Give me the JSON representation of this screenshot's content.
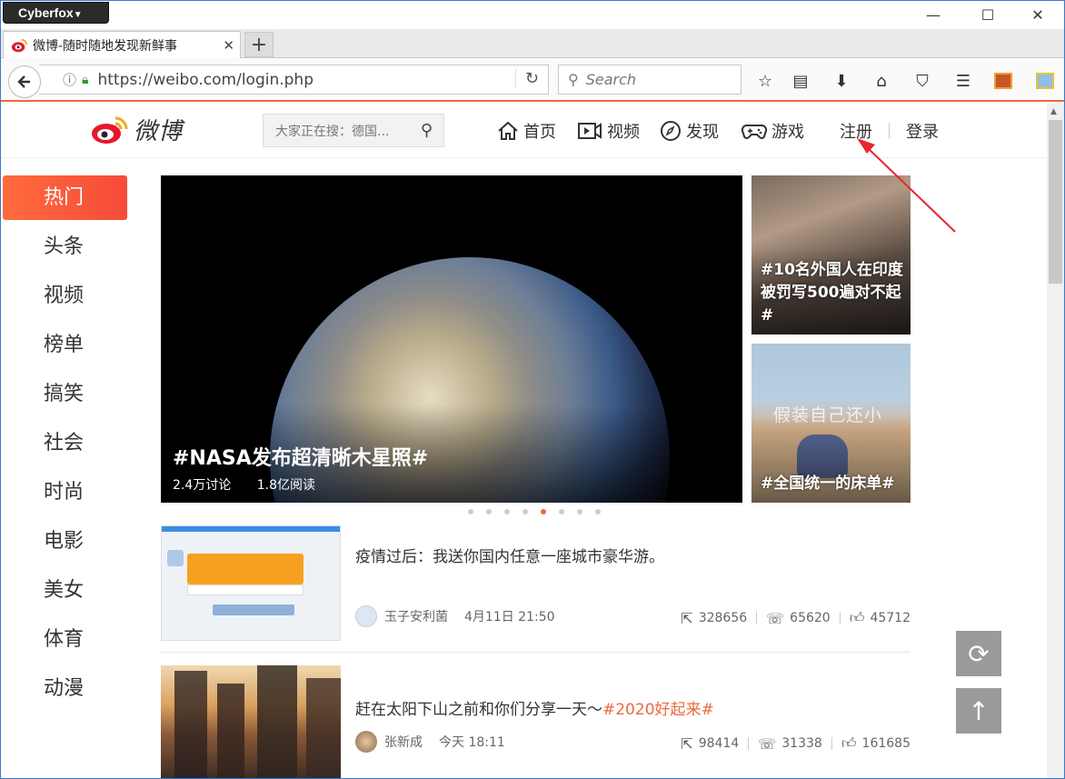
{
  "browser": {
    "app_menu": "Cyberfox",
    "tab_title": "微博-随时随地发现新鲜事",
    "url": "https://weibo.com/login.php",
    "search_placeholder": "Search"
  },
  "header": {
    "logo_text": "微博",
    "search_placeholder": "大家正在搜：德国...",
    "nav": [
      {
        "label": "首页",
        "icon": "home-icon"
      },
      {
        "label": "视频",
        "icon": "video-icon"
      },
      {
        "label": "发现",
        "icon": "compass-icon"
      },
      {
        "label": "游戏",
        "icon": "gamepad-icon"
      }
    ],
    "register": "注册",
    "login": "登录"
  },
  "sidebar": {
    "items": [
      {
        "label": "热门",
        "active": true
      },
      {
        "label": "头条"
      },
      {
        "label": "视频"
      },
      {
        "label": "榜单"
      },
      {
        "label": "搞笑"
      },
      {
        "label": "社会"
      },
      {
        "label": "时尚"
      },
      {
        "label": "电影"
      },
      {
        "label": "美女"
      },
      {
        "label": "体育"
      },
      {
        "label": "动漫"
      }
    ]
  },
  "hero": {
    "title": "#NASA发布超清晰木星照#",
    "discussions": "2.4万讨论",
    "reads": "1.8亿阅读",
    "side": [
      {
        "title": "#10名外国人在印度被罚写500遍对不起#"
      },
      {
        "title": "#全国统一的床单#",
        "overlay_text": "假装自己还小"
      }
    ],
    "dots_count": 8,
    "active_dot": 4
  },
  "feed": [
    {
      "text": "疫情过后：我送你国内任意一座城市豪华游。",
      "tag": "",
      "author": "玉子安利菌",
      "time": "4月11日 21:50",
      "reposts": "328656",
      "comments": "65620",
      "likes": "45712"
    },
    {
      "text": "赶在太阳下山之前和你们分享一天～",
      "tag": "#2020好起来#",
      "author": "张新成",
      "time": "今天 18:11",
      "reposts": "98414",
      "comments": "31338",
      "likes": "161685"
    }
  ],
  "colors": {
    "accent": "#ec6a3a",
    "active_menu": "#f64b3a",
    "annotation_arrow": "#e8262e"
  }
}
